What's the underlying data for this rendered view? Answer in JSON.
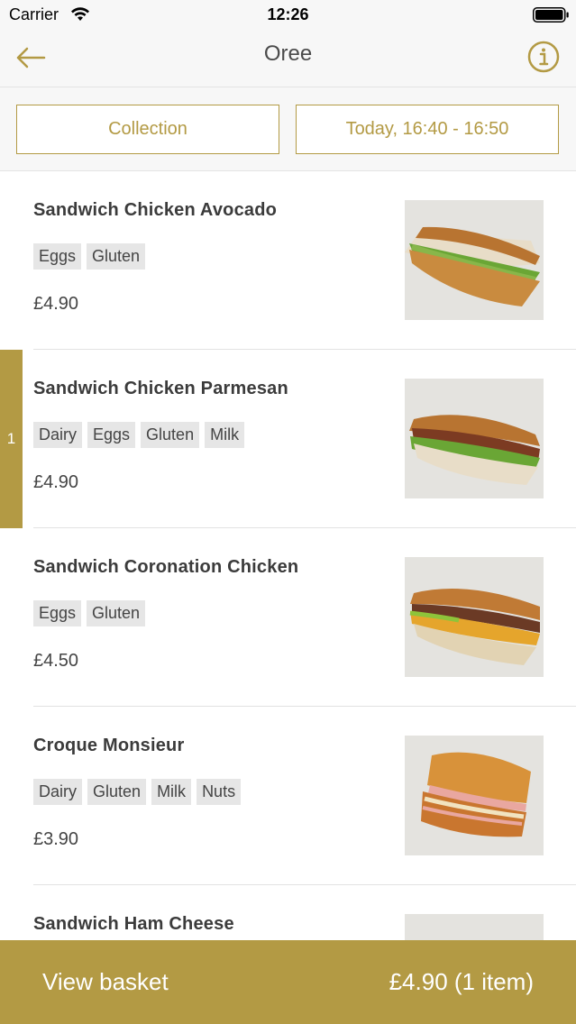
{
  "status_bar": {
    "carrier": "Carrier",
    "time": "12:26"
  },
  "nav": {
    "title": "Oree",
    "back_icon": "arrow-left-icon",
    "info_icon": "info-icon"
  },
  "options": {
    "mode": "Collection",
    "timeslot": "Today, 16:40 - 16:50"
  },
  "colors": {
    "accent": "#b39a44",
    "tag_bg": "#e6e6e6"
  },
  "items": [
    {
      "name": "Sandwich Chicken Avocado",
      "tags": [
        "Eggs",
        "Gluten"
      ],
      "price": "£4.90",
      "quantity": ""
    },
    {
      "name": "Sandwich Chicken Parmesan",
      "tags": [
        "Dairy",
        "Eggs",
        "Gluten",
        "Milk"
      ],
      "price": "£4.90",
      "quantity": "1"
    },
    {
      "name": "Sandwich Coronation Chicken",
      "tags": [
        "Eggs",
        "Gluten"
      ],
      "price": "£4.50",
      "quantity": ""
    },
    {
      "name": "Croque Monsieur",
      "tags": [
        "Dairy",
        "Gluten",
        "Milk",
        "Nuts"
      ],
      "price": "£3.90",
      "quantity": ""
    },
    {
      "name": "Sandwich Ham Cheese",
      "tags": [],
      "price": "",
      "quantity": ""
    }
  ],
  "basket": {
    "label": "View basket",
    "total": "£4.90 (1 item)"
  }
}
